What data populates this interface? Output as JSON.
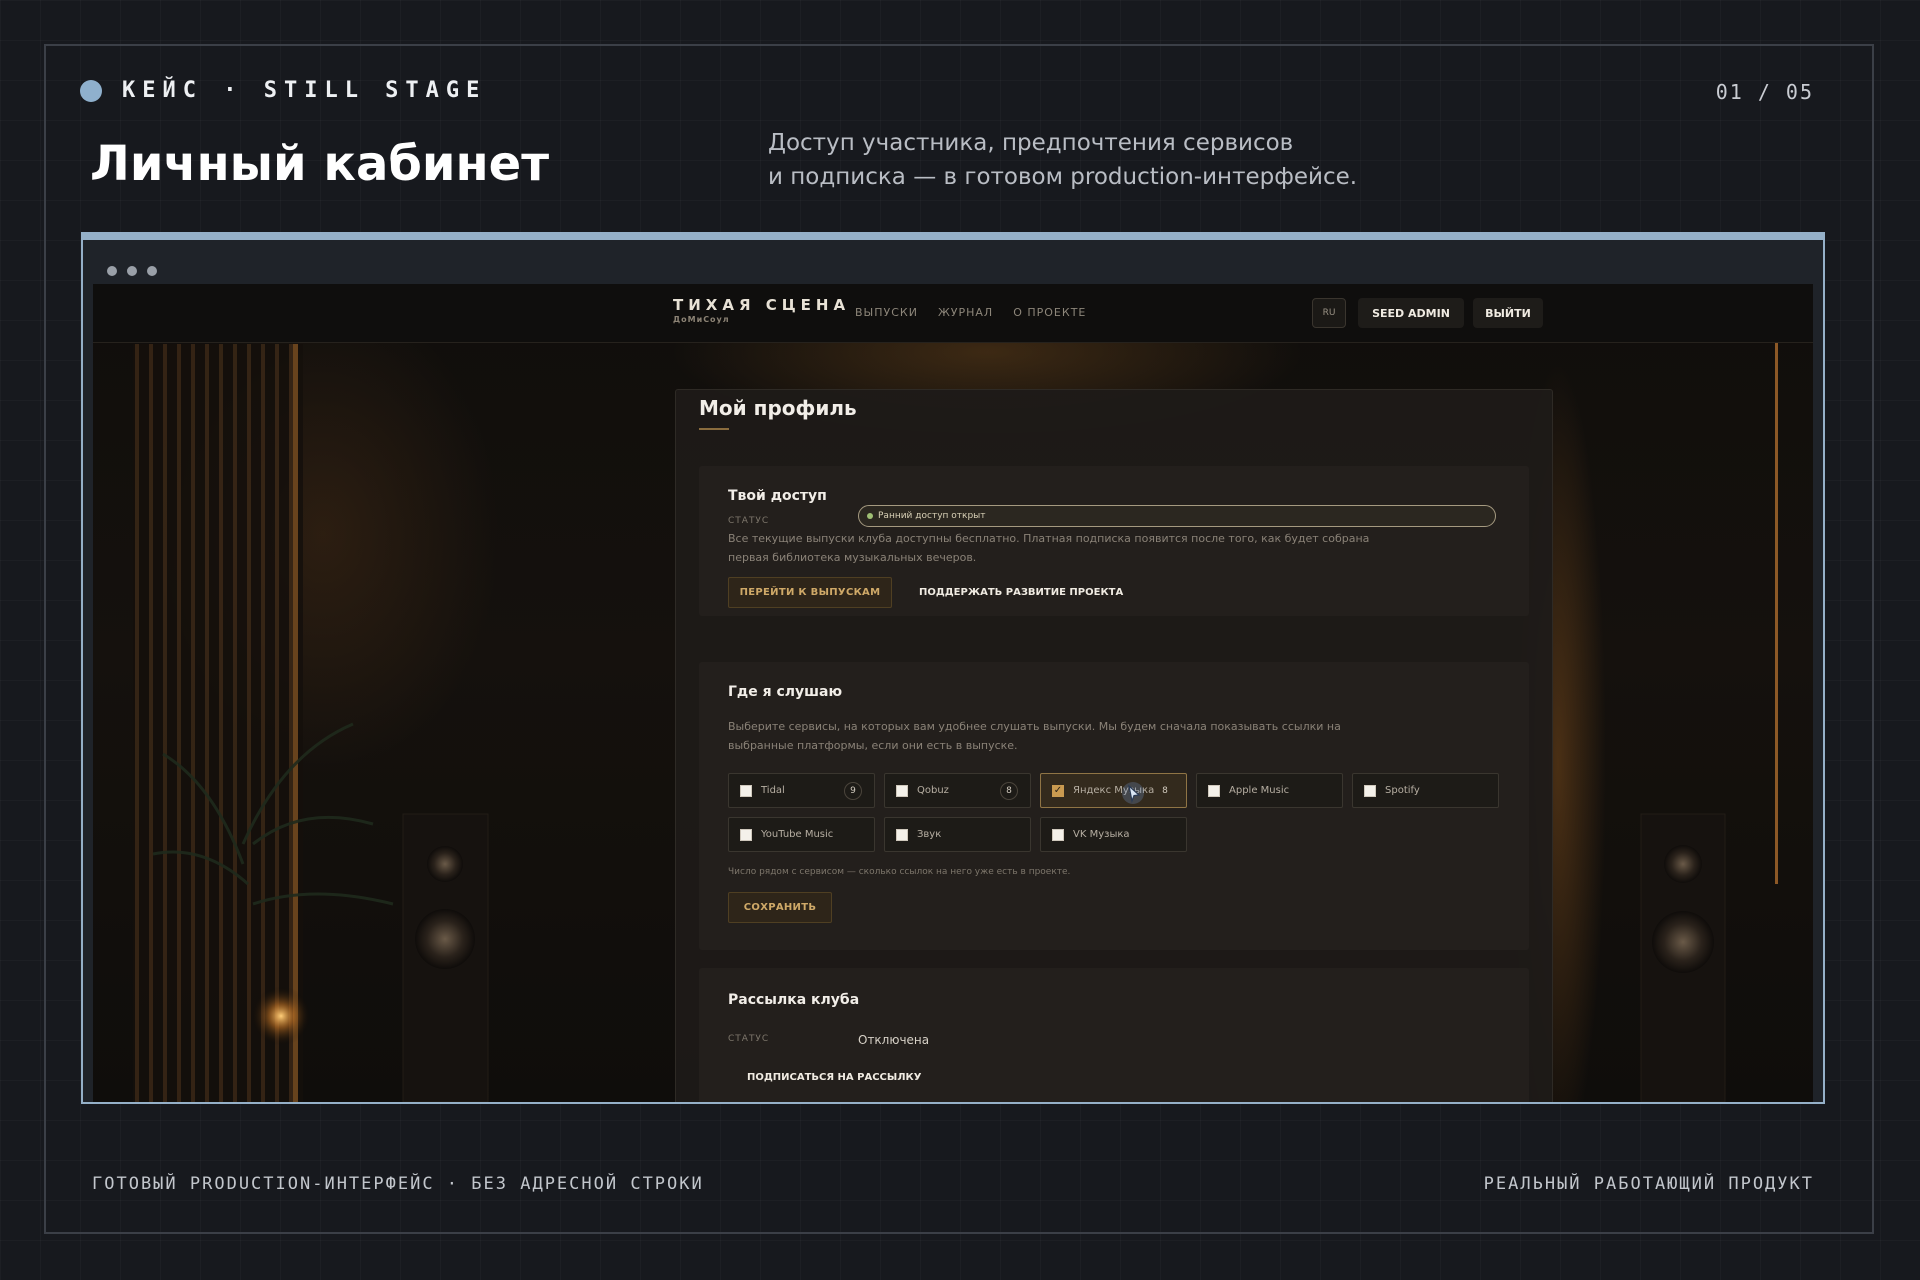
{
  "slide": {
    "brand": "КЕЙС · STILL STAGE",
    "counter": "01 / 05",
    "title": "Личный кабинет",
    "lead_line1": "Доступ участника, предпочтения сервисов",
    "lead_line2": "и подписка — в готовом production-интерфейсе.",
    "footer_left": "ГОТОВЫЙ PRODUCTION-ИНТЕРФЕЙС · БЕЗ АДРЕСНОЙ СТРОКИ",
    "footer_right": "РЕАЛЬНЫЙ РАБОТАЮЩИЙ ПРОДУКТ"
  },
  "site": {
    "title": "ТИХАЯ СЦЕНА",
    "subtitle": "ДоМиСоул",
    "nav": [
      "ВЫПУСКИ",
      "ЖУРНАЛ",
      "О ПРОЕКТЕ"
    ],
    "lang": "RU",
    "user": "SEED ADMIN",
    "logout": "ВЫЙТИ"
  },
  "profile": {
    "title": "Мой профиль",
    "access": {
      "title": "Твой доступ",
      "status_label": "СТАТУС",
      "status_value": "Ранний доступ открыт",
      "desc_line1": "Все текущие выпуски клуба доступны бесплатно. Платная подписка появится после того, как будет собрана",
      "desc_line2": "первая библиотека музыкальных вечеров.",
      "primary_button": "ПЕРЕЙТИ К ВЫПУСКАМ",
      "secondary_button": "ПОДДЕРЖАТЬ РАЗВИТИЕ ПРОЕКТА"
    },
    "listen": {
      "title": "Где я слушаю",
      "desc_line1": "Выберите сервисы, на которых вам удобнее слушать выпуски. Мы будем сначала показывать ссылки на",
      "desc_line2": "выбранные платформы, если они есть в выпуске.",
      "services": [
        {
          "name": "Tidal",
          "count": "9",
          "checked": false
        },
        {
          "name": "Qobuz",
          "count": "8",
          "checked": false
        },
        {
          "name": "Яндекс Музыка",
          "count": "8",
          "checked": true
        },
        {
          "name": "Apple Music",
          "count": "",
          "checked": false
        },
        {
          "name": "Spotify",
          "count": "",
          "checked": false
        },
        {
          "name": "YouTube Music",
          "count": "",
          "checked": false
        },
        {
          "name": "Звук",
          "count": "",
          "checked": false
        },
        {
          "name": "VK Музыка",
          "count": "",
          "checked": false
        }
      ],
      "hint": "Число рядом с сервисом — сколько ссылок на него уже есть в проекте.",
      "save_button": "СОХРАНИТЬ"
    },
    "mailing": {
      "title": "Рассылка клуба",
      "status_label": "СТАТУС",
      "status_value": "Отключена",
      "subscribe_button": "ПОДПИСАТЬСЯ НА РАССЫЛКУ"
    }
  },
  "colors": {
    "accent_blue": "#95b0c8",
    "gold": "#cfa968",
    "status_green": "#9fbf74"
  },
  "icons": {
    "brand": "brand-dot-icon",
    "cursor": "mouse-cursor-icon",
    "checkbox": "checkbox-icon"
  }
}
